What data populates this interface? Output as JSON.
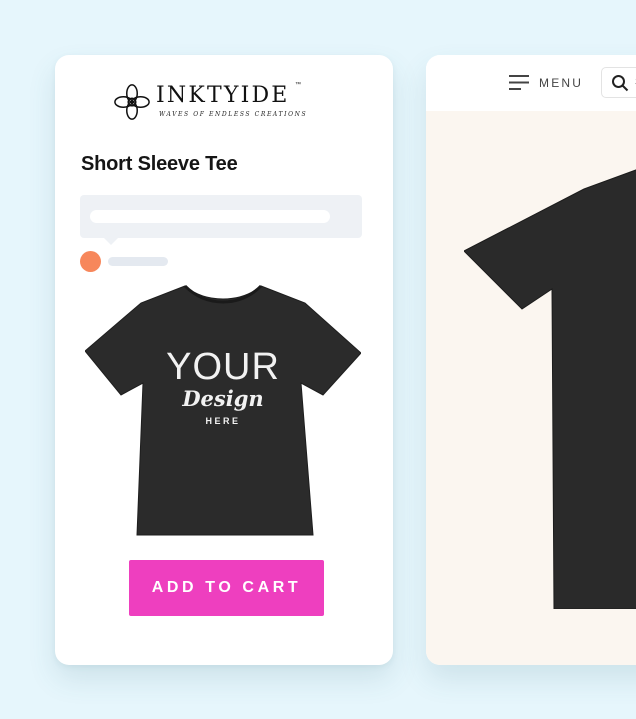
{
  "brand": {
    "name": "INKTYIDE",
    "trademark": "™",
    "tagline": "WAVES OF ENDLESS CREATIONS"
  },
  "product": {
    "title": "Short Sleeve Tee",
    "print_lines": [
      "YOUR",
      "Design",
      "HERE"
    ],
    "shirt_color": "#2a2a2a",
    "add_to_cart_label": "ADD TO CART",
    "button_color": "#ee3fbf",
    "swatch_color": "#f7875b"
  },
  "second_screen": {
    "menu_label": "MENU",
    "search_text": "S",
    "background_color": "#fbf6f0"
  }
}
